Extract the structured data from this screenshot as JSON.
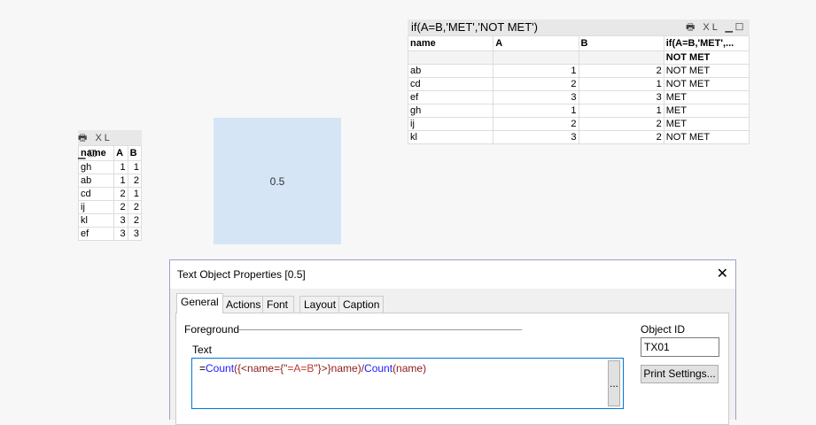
{
  "big_table": {
    "title": "if(A=B,'MET','NOT  MET')",
    "icons": [
      "print-icon",
      "xl-icon",
      "minimize-icon",
      "maximize-icon"
    ],
    "xl": "XL",
    "headers": [
      "name",
      "A",
      "B",
      "if(A=B,'MET',..."
    ],
    "total": "NOT MET",
    "rows": [
      [
        "ab",
        "1",
        "2",
        "NOT MET"
      ],
      [
        "cd",
        "2",
        "1",
        "NOT MET"
      ],
      [
        "ef",
        "3",
        "3",
        "MET"
      ],
      [
        "gh",
        "1",
        "1",
        "MET"
      ],
      [
        "ij",
        "2",
        "2",
        "MET"
      ],
      [
        "kl",
        "3",
        "2",
        "NOT MET"
      ]
    ]
  },
  "small_table": {
    "xl": "XL",
    "headers": [
      "name",
      "A",
      "B"
    ],
    "rows": [
      [
        "gh",
        "1",
        "1"
      ],
      [
        "ab",
        "1",
        "2"
      ],
      [
        "cd",
        "2",
        "1"
      ],
      [
        "ij",
        "2",
        "2"
      ],
      [
        "kl",
        "3",
        "2"
      ],
      [
        "ef",
        "3",
        "3"
      ]
    ]
  },
  "text_object": {
    "value": "0.5"
  },
  "dialog": {
    "title": "Text Object Properties [0.5]",
    "tabs": [
      "General",
      "Actions",
      "Font",
      "Layout",
      "Caption"
    ],
    "foreground": "Foreground",
    "text_label": "Text",
    "expression": [
      {
        "t": "=",
        "c": "#000000"
      },
      {
        "t": "Count",
        "c": "#1a1aff"
      },
      {
        "t": "({<name={\"",
        "c": "#8b1a1a"
      },
      {
        "t": "=A=B",
        "c": "#c0392b"
      },
      {
        "t": "\"}>}name)/",
        "c": "#8b1a1a"
      },
      {
        "t": "Count",
        "c": "#1a1aff"
      },
      {
        "t": "(name)",
        "c": "#8b1a1a"
      }
    ],
    "ellipsis": "...",
    "object_id_label": "Object ID",
    "object_id": "TX01",
    "print_settings": "Print Settings..."
  }
}
